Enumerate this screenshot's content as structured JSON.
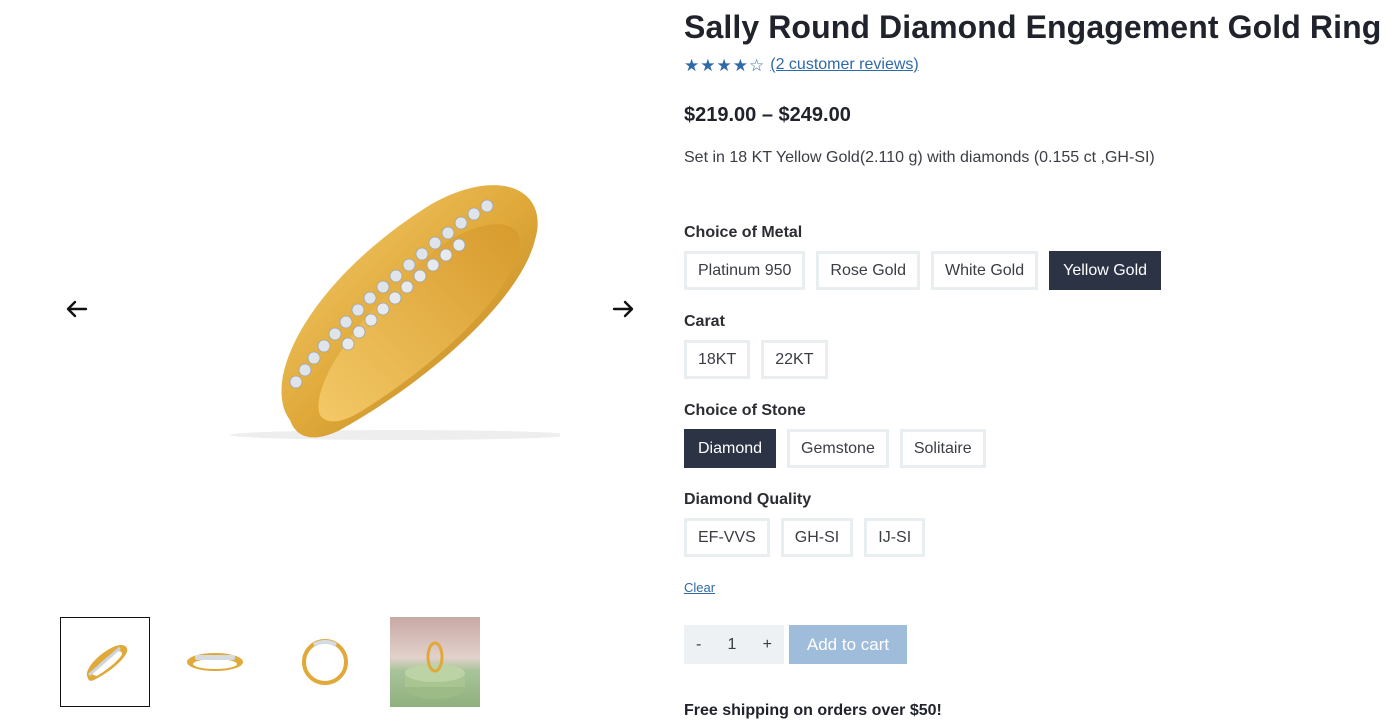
{
  "product": {
    "title": "Sally Round Diamond Engagement Gold Ring",
    "rating": {
      "stars": [
        "★",
        "★",
        "★",
        "★",
        "☆"
      ],
      "filled": 4,
      "max": 5,
      "reviews_text": "(2 customer reviews)"
    },
    "price": "$219.00 – $249.00",
    "description": "Set in 18 KT Yellow Gold(2.110 g) with diamonds (0.155 ct ,GH-SI)"
  },
  "attributes": [
    {
      "label": "Choice of Metal",
      "options": [
        "Platinum 950",
        "Rose Gold",
        "White Gold",
        "Yellow Gold"
      ],
      "selected": "Yellow Gold"
    },
    {
      "label": "Carat",
      "options": [
        "18KT",
        "22KT"
      ],
      "selected": null
    },
    {
      "label": "Choice of Stone",
      "options": [
        "Diamond",
        "Gemstone",
        "Solitaire"
      ],
      "selected": "Diamond"
    },
    {
      "label": "Diamond Quality",
      "options": [
        "EF-VVS",
        "GH-SI",
        "IJ-SI"
      ],
      "selected": null
    }
  ],
  "clear_label": "Clear",
  "cart": {
    "minus": "-",
    "quantity": "1",
    "plus": "+",
    "add_label": "Add to cart"
  },
  "shipping_text": "Free shipping on orders over $50!",
  "gallery": {
    "prev_icon": "arrow-left-icon",
    "next_icon": "arrow-right-icon",
    "thumbnails": [
      "ring-angle",
      "ring-side",
      "ring-top",
      "ring-lifestyle"
    ],
    "active_thumbnail": 0
  },
  "colors": {
    "accent": "#2f6aa8",
    "selected": "#2c3345",
    "add_to_cart": "#9fbcdb",
    "gold": "#e0a93a"
  }
}
